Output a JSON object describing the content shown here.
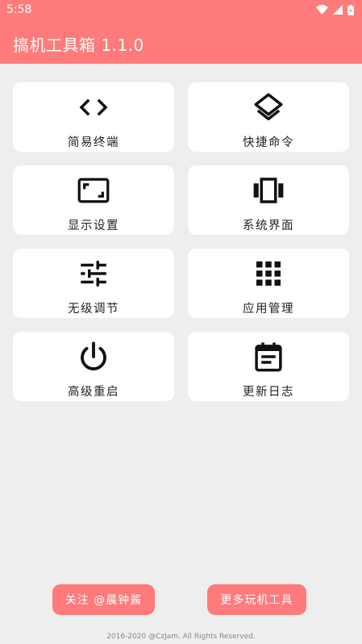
{
  "status_bar": {
    "time": "5:58",
    "icons": [
      "wifi-icon",
      "signal-icon",
      "battery-icon"
    ]
  },
  "app": {
    "title": "搞机工具箱 1.1.0",
    "accent_color": "#ff7a7a"
  },
  "tiles": [
    {
      "label": "简易终端",
      "icon": "code-icon"
    },
    {
      "label": "快捷命令",
      "icon": "layers-icon"
    },
    {
      "label": "显示设置",
      "icon": "aspect-ratio-icon"
    },
    {
      "label": "系统界面",
      "icon": "view-carousel-icon"
    },
    {
      "label": "无级调节",
      "icon": "sliders-icon"
    },
    {
      "label": "应用管理",
      "icon": "apps-grid-icon"
    },
    {
      "label": "高级重启",
      "icon": "power-icon"
    },
    {
      "label": "更新日志",
      "icon": "event-note-icon"
    }
  ],
  "buttons": {
    "follow": "关注 @晨钟酱",
    "more": "更多玩机工具"
  },
  "footer": "2016-2020 @CzJam. All Rights Reserved."
}
